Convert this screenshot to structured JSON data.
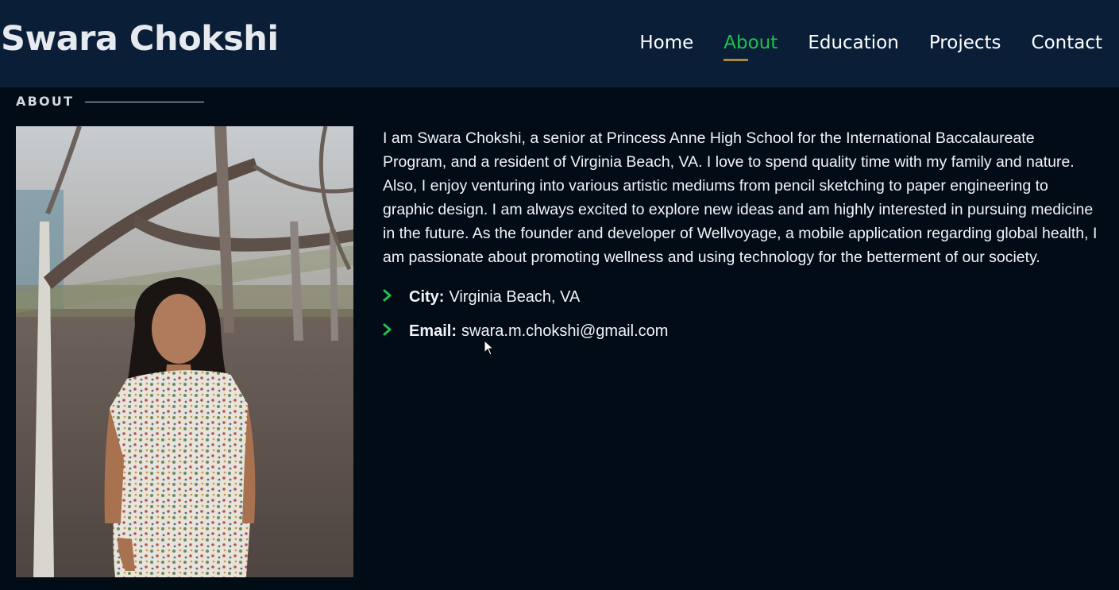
{
  "header": {
    "site_title": "Swara Chokshi",
    "nav": [
      {
        "label": "Home",
        "active": false
      },
      {
        "label": "About",
        "active": true
      },
      {
        "label": "Education",
        "active": false
      },
      {
        "label": "Projects",
        "active": false
      },
      {
        "label": "Contact",
        "active": false
      }
    ]
  },
  "about": {
    "section_label": "ABOUT",
    "bio": "I am Swara Chokshi, a senior at Princess Anne High School for the International Baccalaureate Program, and a resident of Virginia Beach, VA. I love to spend quality time with my family and nature. Also, I enjoy venturing into various artistic mediums from pencil sketching to paper engineering to graphic design. I am always excited to explore new ideas and am highly interested in pursuing medicine in the future. As the founder and developer of Wellvoyage, a mobile application regarding global health, I am passionate about promoting wellness and using technology for the betterment of our society.",
    "details": [
      {
        "key": "City:",
        "value": "Virginia Beach, VA"
      },
      {
        "key": "Email:",
        "value": "swara.m.chokshi@gmail.com"
      }
    ]
  },
  "colors": {
    "header_bg": "#0a1e38",
    "page_bg": "#010c17",
    "accent_green": "#1fc04f",
    "underline_gold": "#a68a3c"
  },
  "icons": {
    "detail_bullet": "chevron-right-icon",
    "pointer": "mouse-cursor-icon"
  }
}
